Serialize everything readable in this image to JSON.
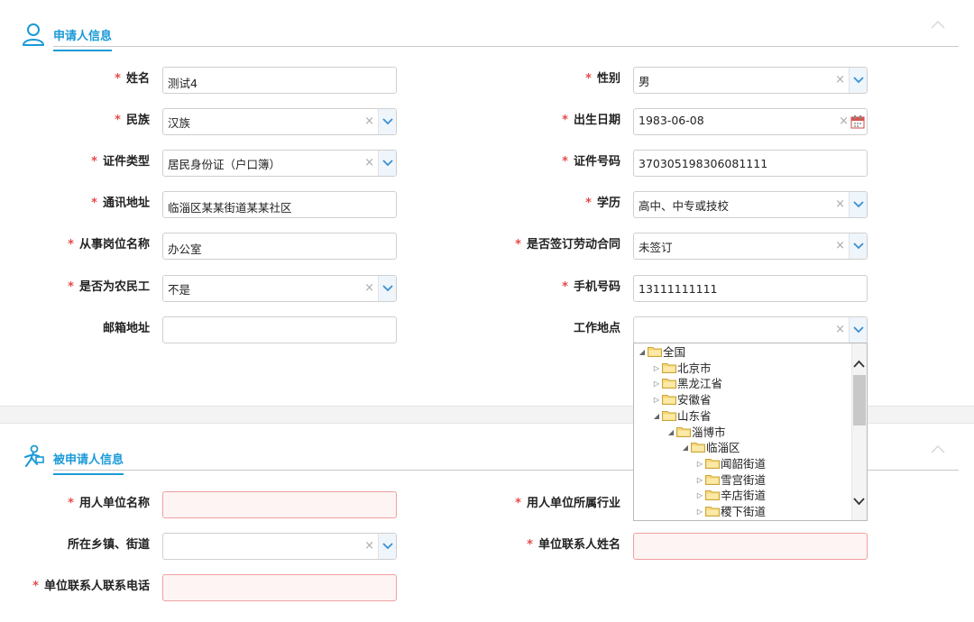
{
  "applicant": {
    "title": "申请人信息",
    "name_label": "姓名",
    "name_value": "测试4",
    "gender_label": "性别",
    "gender_value": "男",
    "ethnicity_label": "民族",
    "ethnicity_value": "汉族",
    "birth_label": "出生日期",
    "birth_value": "1983-06-08",
    "id_type_label": "证件类型",
    "id_type_value": "居民身份证（户口簿）",
    "id_no_label": "证件号码",
    "id_no_value": "370305198306081111",
    "address_label": "通讯地址",
    "address_value": "临淄区某某街道某某社区",
    "education_label": "学历",
    "education_value": "高中、中专或技校",
    "job_label": "从事岗位名称",
    "job_value": "办公室",
    "contract_label": "是否签订劳动合同",
    "contract_value": "未签订",
    "migrant_label": "是否为农民工",
    "migrant_value": "不是",
    "phone_label": "手机号码",
    "phone_value": "13111111111",
    "email_label": "邮箱地址",
    "email_value": "",
    "workplace_label": "工作地点",
    "workplace_value": "",
    "required_mark": "*",
    "clear_glyph": "×"
  },
  "tree": {
    "nodes": [
      {
        "label": "全国",
        "toggle": "◢",
        "level": 0
      },
      {
        "label": "北京市",
        "toggle": "▷",
        "level": 1
      },
      {
        "label": "黑龙江省",
        "toggle": "▷",
        "level": 1
      },
      {
        "label": "安徽省",
        "toggle": "▷",
        "level": 1
      },
      {
        "label": "山东省",
        "toggle": "◢",
        "level": 1
      },
      {
        "label": "淄博市",
        "toggle": "◢",
        "level": 2
      },
      {
        "label": "临淄区",
        "toggle": "◢",
        "level": 3
      },
      {
        "label": "闻韶街道",
        "toggle": "▷",
        "level": 4
      },
      {
        "label": "雪宫街道",
        "toggle": "▷",
        "level": 4
      },
      {
        "label": "辛店街道",
        "toggle": "▷",
        "level": 4
      },
      {
        "label": "稷下街道",
        "toggle": "▷",
        "level": 4
      }
    ]
  },
  "respondent": {
    "title": "被申请人信息",
    "employer_label": "用人单位名称",
    "employer_value": "",
    "industry_label": "用人单位所属行业",
    "town_label": "所在乡镇、街道",
    "town_value": "",
    "contact_name_label": "单位联系人姓名",
    "contact_name_value": "",
    "contact_phone_label": "单位联系人联系电话",
    "contact_phone_value": ""
  },
  "colors": {
    "accent": "#1a9ad8",
    "required": "#e64a4a",
    "error_border": "#f0a0a0",
    "error_bg": "#fff4f4"
  }
}
